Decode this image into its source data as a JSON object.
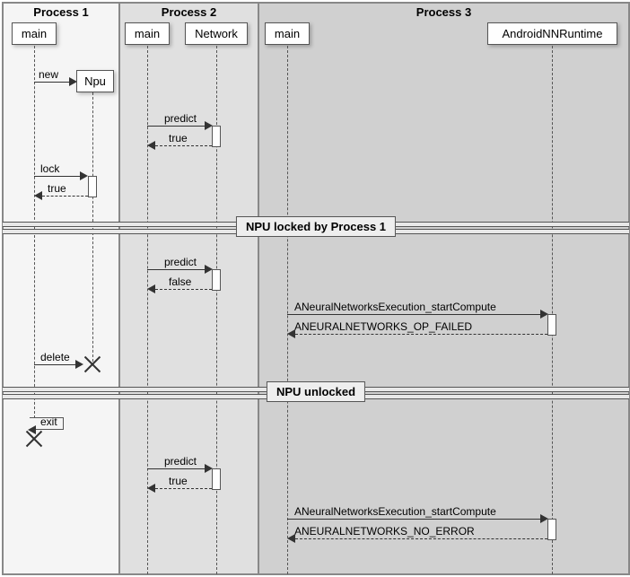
{
  "groups": {
    "p1": {
      "title": "Process 1"
    },
    "p2": {
      "title": "Process 2"
    },
    "p3": {
      "title": "Process 3"
    }
  },
  "participants": {
    "p1_main": "main",
    "npu": "Npu",
    "p2_main": "main",
    "network": "Network",
    "p3_main": "main",
    "annr": "AndroidNNRuntime"
  },
  "messages": {
    "m_new": "new",
    "m_predict1": "predict",
    "m_true1": "true",
    "m_lock": "lock",
    "m_locktrue": "true",
    "m_predict2": "predict",
    "m_false": "false",
    "m_start1": "ANeuralNetworksExecution_startCompute",
    "m_opfail": "ANEURALNETWORKS_OP_FAILED",
    "m_delete": "delete",
    "m_exit": "exit",
    "m_predict3": "predict",
    "m_true3": "true",
    "m_start2": "ANeuralNetworksExecution_startCompute",
    "m_noerr": "ANEURALNETWORKS_NO_ERROR"
  },
  "dividers": {
    "d1": "NPU locked by Process 1",
    "d2": "NPU unlocked"
  },
  "colors": {
    "p1_bg": "#f5f5f5",
    "p2_bg": "#e0e0e0",
    "p3_bg": "#d0d0d0"
  }
}
